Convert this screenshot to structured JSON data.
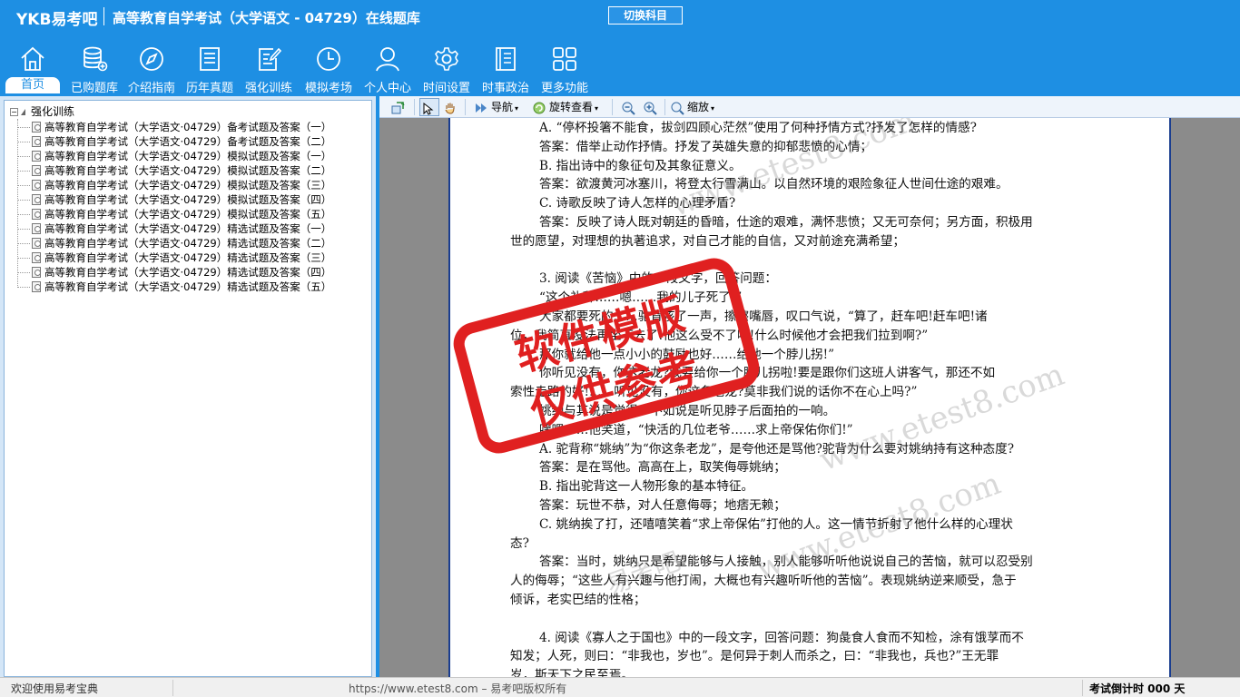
{
  "header": {
    "brand": "YKB易考吧",
    "title": "高等教育自学考试（大学语文 - 04729）在线题库",
    "switch_label": "切换科目"
  },
  "nav": [
    {
      "label": "首页",
      "icon": "home-icon",
      "active": true
    },
    {
      "label": "已购题库",
      "icon": "database-icon"
    },
    {
      "label": "介绍指南",
      "icon": "compass-icon"
    },
    {
      "label": "历年真题",
      "icon": "list-icon"
    },
    {
      "label": "强化训练",
      "icon": "edit-icon"
    },
    {
      "label": "模拟考场",
      "icon": "clock-icon"
    },
    {
      "label": "个人中心",
      "icon": "user-icon"
    },
    {
      "label": "时间设置",
      "icon": "gear-icon"
    },
    {
      "label": "时事政治",
      "icon": "news-icon"
    },
    {
      "label": "更多功能",
      "icon": "grid-icon"
    }
  ],
  "tree": {
    "root": "强化训练",
    "items": [
      "高等教育自学考试（大学语文·04729）备考试题及答案（一）",
      "高等教育自学考试（大学语文·04729）备考试题及答案（二）",
      "高等教育自学考试（大学语文·04729）模拟试题及答案（一）",
      "高等教育自学考试（大学语文·04729）模拟试题及答案（二）",
      "高等教育自学考试（大学语文·04729）模拟试题及答案（三）",
      "高等教育自学考试（大学语文·04729）模拟试题及答案（四）",
      "高等教育自学考试（大学语文·04729）模拟试题及答案（五）",
      "高等教育自学考试（大学语文·04729）精选试题及答案（一）",
      "高等教育自学考试（大学语文·04729）精选试题及答案（二）",
      "高等教育自学考试（大学语文·04729）精选试题及答案（三）",
      "高等教育自学考试（大学语文·04729）精选试题及答案（四）",
      "高等教育自学考试（大学语文·04729）精选试题及答案（五）"
    ]
  },
  "toolbar": {
    "nav_label": "导航",
    "rotate_label": "旋转查看",
    "zoom_label": "缩放"
  },
  "document": {
    "lines": [
      {
        "text": "A. “停杯投箸不能食，拔剑四顾心茫然”使用了何种抒情方式?抒发了怎样的情感?",
        "indent": true
      },
      {
        "text": "答案：借举止动作抒情。抒发了英雄失意的抑郁悲愤的心情；",
        "indent": true
      },
      {
        "text": "B. 指出诗中的象征句及其象征意义。",
        "indent": true
      },
      {
        "text": "答案：欲渡黄河冰塞川，将登太行雪满山。以自然环境的艰险象征人世间仕途的艰难。",
        "indent": true
      },
      {
        "text": "C. 诗歌反映了诗人怎样的心理矛盾?",
        "indent": true
      },
      {
        "text": "答案：反映了诗人既对朝廷的昏暗，仕途的艰难，满怀悲愤；又无可奈何；另方面，积极用",
        "indent": true
      },
      {
        "text": "世的愿望，对理想的执著追求，对自己才能的自信，又对前途充满希望；",
        "indent": false
      },
      {
        "text": "",
        "indent": false
      },
      {
        "text": "3. 阅读《苦恼》中的一段文字，回答问题：",
        "indent": true
      },
      {
        "text": "“这个礼拜……嗯……我的儿子死了!”",
        "indent": true
      },
      {
        "text": "大家都要死的……驼背咳了一声，擦擦嘴唇，叹口气说，“算了，赶车吧!赶车吧!诸",
        "indent": true
      },
      {
        "text": "位，我简直没法再坐下去了!他这么受不了啦!什么时候他才会把我们拉到啊?”",
        "indent": false
      },
      {
        "text": "那你就给他一点小小的鼓励也好……给他一个脖儿拐!”",
        "indent": true
      },
      {
        "text": "你听见没有，你这老龙?我要给你一个脖儿拐啦!要是跟你们这班人讲客气，那还不如",
        "indent": true
      },
      {
        "text": "索性走路的好!……听见没有，你这条老龙?莫非我们说的话你不在心上吗?”",
        "indent": false
      },
      {
        "text": "姚纳与其说是觉得，不如说是听见脖子后面拍的一响。",
        "indent": true
      },
      {
        "text": "嘿嘿……他笑道，“快活的几位老爷……求上帝保佑你们!”",
        "indent": true
      },
      {
        "text": "A. 驼背称“姚纳”为“你这条老龙”，是夸他还是骂他?驼背为什么要对姚纳持有这种态度?",
        "indent": true
      },
      {
        "text": "答案：是在骂他。高高在上，取笑侮辱姚纳；",
        "indent": true
      },
      {
        "text": "B. 指出驼背这一人物形象的基本特征。",
        "indent": true
      },
      {
        "text": "答案：玩世不恭，对人任意侮辱；地痞无赖；",
        "indent": true
      },
      {
        "text": "C. 姚纳挨了打，还嘻嘻笑着“求上帝保佑”打他的人。这一情节折射了他什么样的心理状",
        "indent": true
      },
      {
        "text": "态?",
        "indent": false
      },
      {
        "text": "答案：当时，姚纳只是希望能够与人接触，别人能够听听他说说自己的苦恼，就可以忍受别",
        "indent": true
      },
      {
        "text": "人的侮辱；“这些人有兴趣与他打闹，大概也有兴趣听听他的苦恼”。表现姚纳逆来顺受，急于",
        "indent": false
      },
      {
        "text": "倾诉，老实巴结的性格；",
        "indent": false
      },
      {
        "text": "",
        "indent": false
      },
      {
        "text": "4. 阅读《寡人之于国也》中的一段文字，回答问题：狗彘食人食而不知检，涂有饿莩而不",
        "indent": true
      },
      {
        "text": "知发；人死，则曰：“非我也，岁也”。是何异于刺人而杀之，曰：“非我也，兵也?”王无罪",
        "indent": false
      },
      {
        "text": "岁，斯天下之民至焉。",
        "indent": false
      }
    ],
    "stamp_line1": "软件模版",
    "stamp_line2": "仅供参考",
    "watermark": "www.etest8.com",
    "watermark_cn": "易考吧"
  },
  "status": {
    "left": "欢迎使用易考宝典",
    "mid": "https://www.etest8.com – 易考吧版权所有",
    "right": "考试倒计时 000 天"
  },
  "colors": {
    "primary": "#1e8fe3",
    "stamp": "#e02020",
    "doc_border": "#1a3d8f"
  }
}
